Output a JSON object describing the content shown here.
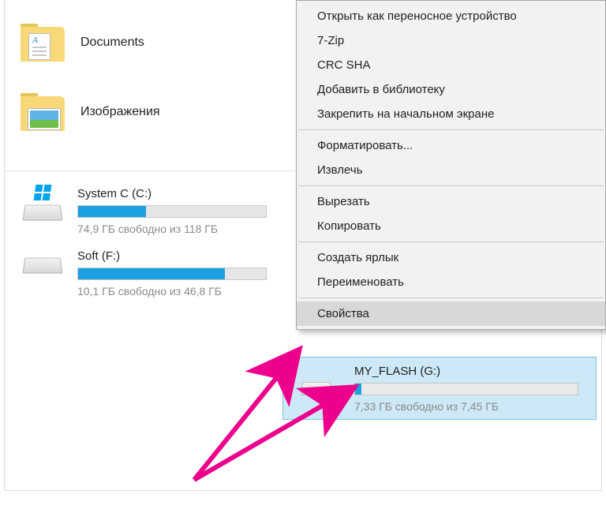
{
  "libraries": [
    {
      "label": "Documents",
      "icon": "documents"
    },
    {
      "label": "Изображения",
      "icon": "pictures"
    }
  ],
  "drives": {
    "systemC": {
      "name": "System C (C:)",
      "free_text": "74,9 ГБ свободно из 118 ГБ",
      "fill_percent": 36
    },
    "softF": {
      "name": "Soft (F:)",
      "free_text": "10,1 ГБ свободно из 46,8 ГБ",
      "fill_percent": 78
    },
    "flashG": {
      "name": "MY_FLASH (G:)",
      "free_text": "7,33 ГБ свободно из 7,45 ГБ",
      "fill_percent": 3
    }
  },
  "context_menu": {
    "groups": [
      [
        "Открыть как переносное устройство",
        "7-Zip",
        "CRC SHA",
        "Добавить в библиотеку",
        "Закрепить на начальном экране"
      ],
      [
        "Форматировать...",
        "Извлечь"
      ],
      [
        "Вырезать",
        "Копировать"
      ],
      [
        "Создать ярлык",
        "Переименовать"
      ],
      [
        "Свойства"
      ]
    ],
    "hovered": "Свойства"
  },
  "annotation_color": "#ec008c"
}
